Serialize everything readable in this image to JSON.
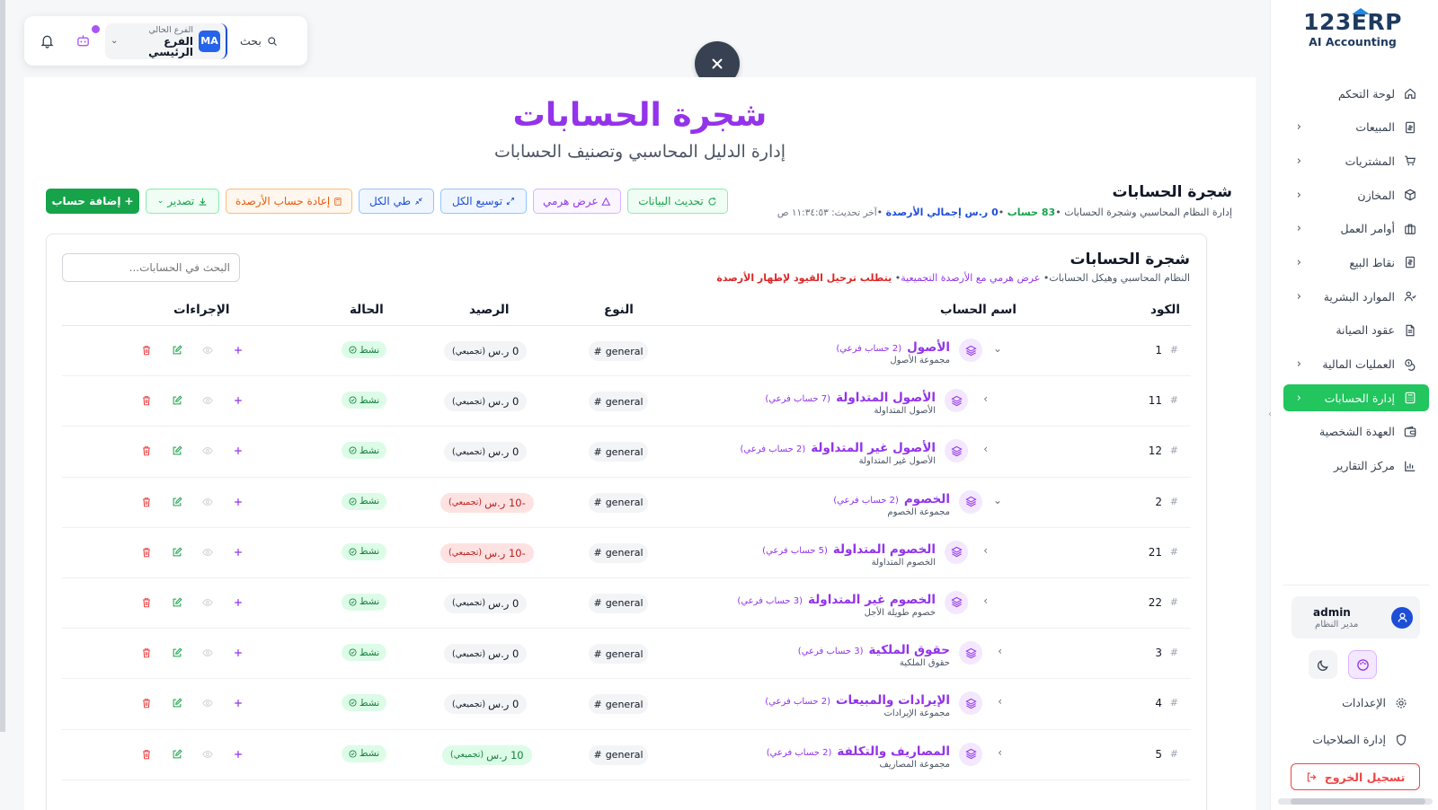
{
  "brand": {
    "main": "123ERP",
    "sub": "AI Accounting"
  },
  "sidebar": {
    "items": [
      {
        "label": "لوحة التحكم",
        "icon": "home-icon",
        "chevron": false,
        "active": false
      },
      {
        "label": "المبيعات",
        "icon": "invoice-icon",
        "chevron": true,
        "active": false
      },
      {
        "label": "المشتريات",
        "icon": "cart-icon",
        "chevron": true,
        "active": false
      },
      {
        "label": "المخازن",
        "icon": "box-icon",
        "chevron": true,
        "active": false
      },
      {
        "label": "أوامر العمل",
        "icon": "briefcase-icon",
        "chevron": true,
        "active": false
      },
      {
        "label": "نقاط البيع",
        "icon": "pos-icon",
        "chevron": true,
        "active": false
      },
      {
        "label": "الموارد البشرية",
        "icon": "users-icon",
        "chevron": true,
        "active": false
      },
      {
        "label": "عقود الصيانة",
        "icon": "document-icon",
        "chevron": false,
        "active": false
      },
      {
        "label": "العمليات المالية",
        "icon": "coins-icon",
        "chevron": true,
        "active": false
      },
      {
        "label": "إدارة الحسابات",
        "icon": "calculator-icon",
        "chevron": true,
        "active": true
      },
      {
        "label": "العهدة الشخصية",
        "icon": "wallet-icon",
        "chevron": false,
        "active": false
      },
      {
        "label": "مركز التقارير",
        "icon": "bar-chart-icon",
        "chevron": false,
        "active": false
      }
    ],
    "user": {
      "name": "admin",
      "role": "مدير النظام"
    },
    "settings_label": "الإعدادات",
    "permissions_label": "إدارة الصلاحيات",
    "logout_label": "تسجيل الخروج"
  },
  "topbar": {
    "search_label": "بحث",
    "branch_caption": "الفرع الحالي",
    "branch_name": "الفرع الرئيسي",
    "branch_badge": "MA"
  },
  "header": {
    "title": "شجرة الحسابات",
    "subtitle": "إدارة الدليل المحاسبي وتصنيف الحسابات"
  },
  "section": {
    "title": "شجرة الحسابات",
    "meta_prefix": "إدارة النظام المحاسبي وشجرة الحسابات",
    "meta_count": "83 حساب",
    "meta_total": "0 ر.س إجمالي الأرصدة",
    "meta_updated": "آخر تحديث: ١١:٣٤:٥٣ ص"
  },
  "toolbar": {
    "add": "إضافة حساب",
    "export": "تصدير",
    "recalc": "إعادة حساب الأرصدة",
    "collapse": "طي الكل",
    "expand": "توسيع الكل",
    "tree": "عرض هرمي",
    "refresh": "تحديث البيانات"
  },
  "card": {
    "title": "شجرة الحسابات",
    "sub_part1": "النظام المحاسبي وهيكل الحسابات",
    "sub_part2": "عرض هرمي مع الأرصدة التجميعية",
    "sub_part3": "يتطلب ترحيل القيود لإظهار الأرصدة",
    "search_placeholder": "البحث في الحسابات..."
  },
  "table": {
    "headers": {
      "code": "الكود",
      "name": "اسم الحساب",
      "type": "النوع",
      "balance": "الرصيد",
      "status": "الحالة",
      "actions": "الإجراءات"
    },
    "rows": [
      {
        "code": "1",
        "name": "الأصول",
        "count": "(2 حساب فرعي)",
        "desc": "مجموعة الأصول",
        "type": "general",
        "balance": "0 ر.س",
        "agg": "(تجميعي)",
        "balance_kind": "zero",
        "status": "نشط",
        "level": 0,
        "expanded": true
      },
      {
        "code": "11",
        "name": "الأصول المتداولة",
        "count": "(7 حساب فرعي)",
        "desc": "الأصول المتداولة",
        "type": "general",
        "balance": "0 ر.س",
        "agg": "(تجميعي)",
        "balance_kind": "zero",
        "status": "نشط",
        "level": 1,
        "expanded": false
      },
      {
        "code": "12",
        "name": "الأصول غير المتداولة",
        "count": "(2 حساب فرعي)",
        "desc": "الأصول غير المتداولة",
        "type": "general",
        "balance": "0 ر.س",
        "agg": "(تجميعي)",
        "balance_kind": "zero",
        "status": "نشط",
        "level": 1,
        "expanded": false
      },
      {
        "code": "2",
        "name": "الخصوم",
        "count": "(2 حساب فرعي)",
        "desc": "مجموعة الخصوم",
        "type": "general",
        "balance": "-10 ر.س",
        "agg": "(تجميعي)",
        "balance_kind": "neg",
        "status": "نشط",
        "level": 0,
        "expanded": true
      },
      {
        "code": "21",
        "name": "الخصوم المتداولة",
        "count": "(5 حساب فرعي)",
        "desc": "الخصوم المتداولة",
        "type": "general",
        "balance": "-10 ر.س",
        "agg": "(تجميعي)",
        "balance_kind": "neg",
        "status": "نشط",
        "level": 1,
        "expanded": false
      },
      {
        "code": "22",
        "name": "الخصوم غير المتداولة",
        "count": "(3 حساب فرعي)",
        "desc": "خصوم طويلة الأجل",
        "type": "general",
        "balance": "0 ر.س",
        "agg": "(تجميعي)",
        "balance_kind": "zero",
        "status": "نشط",
        "level": 1,
        "expanded": false
      },
      {
        "code": "3",
        "name": "حقوق الملكية",
        "count": "(3 حساب فرعي)",
        "desc": "حقوق الملكية",
        "type": "general",
        "balance": "0 ر.س",
        "agg": "(تجميعي)",
        "balance_kind": "zero",
        "status": "نشط",
        "level": 0,
        "expanded": false
      },
      {
        "code": "4",
        "name": "الإيرادات والمبيعات",
        "count": "(2 حساب فرعي)",
        "desc": "مجموعة الإيرادات",
        "type": "general",
        "balance": "0 ر.س",
        "agg": "(تجميعي)",
        "balance_kind": "zero",
        "status": "نشط",
        "level": 0,
        "expanded": false
      },
      {
        "code": "5",
        "name": "المصاريف والتكلفة",
        "count": "(2 حساب فرعي)",
        "desc": "مجموعة المصاريف",
        "type": "general",
        "balance": "10 ر.س",
        "agg": "(تجميعي)",
        "balance_kind": "pos",
        "status": "نشط",
        "level": 0,
        "expanded": false
      }
    ]
  },
  "colors": {
    "accent_purple": "#9333ea",
    "active_green": "#22c55e",
    "danger": "#ef4444",
    "brand_navy": "#1e3a5f",
    "brand_blue": "#1e88e5"
  }
}
